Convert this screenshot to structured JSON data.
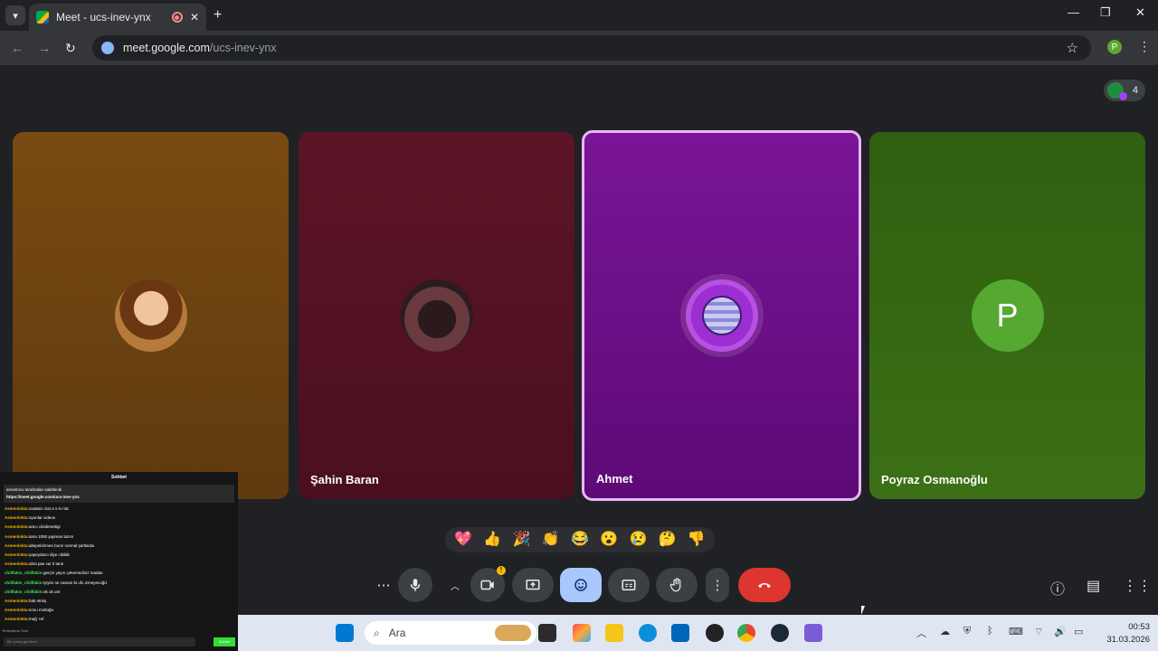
{
  "browser": {
    "tab_title": "Meet - ucs-inev-ynx",
    "url_host": "meet.google.com",
    "url_path": "/ucs-inev-ynx",
    "profile_initial": "P"
  },
  "meet": {
    "participant_count": "4",
    "participants": [
      {
        "name": ""
      },
      {
        "name": "Şahin Baran"
      },
      {
        "name": "Ahmet"
      },
      {
        "name": "Poyraz Osmanoğlu",
        "initial": "P"
      }
    ],
    "reactions": [
      "💖",
      "👍",
      "🎉",
      "👏",
      "😂",
      "😮",
      "😢",
      "🤔",
      "👎"
    ]
  },
  "chat_overlay": {
    "title": "Sohbet",
    "pinned_line1": "amanlocu tarafından sabitlendi",
    "pinned_line2": "https://meet.google.com/ucs-inev-ynx",
    "messages": [
      {
        "user": "Asmenlokta:",
        "text": "oodasin clat a s in ntic"
      },
      {
        "user": "Asmenlokta:",
        "text": "oyunlar videos"
      },
      {
        "user": "Asmenlokta:",
        "text": "amcı cikidenettigi"
      },
      {
        "user": "Asmenlokta:",
        "text": "ama 1000 yapman lazım"
      },
      {
        "user": "Asmenlokta:",
        "text": "altepeldirmen bunn normal şartlarda"
      },
      {
        "user": "Asmenlokta:",
        "text": "yapeydazo diye cikildir"
      },
      {
        "user": "Asmenlokta:",
        "text": "ultra pas var ti tane"
      },
      {
        "user": "chillfakin_chillfakin:",
        "text": "gerçin yayın çekemediniz madan",
        "alt": true
      },
      {
        "user": "chillfakin_chillfakin:",
        "text": "iyiyim ne zaman bi ufo izmeyecoğiz",
        "alt": true
      },
      {
        "user": "chillfakin_chillfakin:",
        "text": "ok ok unt",
        "alt": true
      },
      {
        "user": "Asmenlokta:",
        "text": "hak etmiş"
      },
      {
        "user": "Asmenlokta:",
        "text": "sonu mutluğu"
      },
      {
        "user": "Asmenlokta:",
        "text": "mağ +ef"
      }
    ],
    "footer": "Yerleştirme Öznl",
    "input_placeholder": "Bir mesaj gönderin",
    "send_label": "Sohbet"
  },
  "taskbar": {
    "search_placeholder": "Ara",
    "time": "00:53",
    "date": "31.03.2026"
  },
  "colors": {
    "meet_bg": "#202124",
    "leave_red": "#dc362e",
    "active_border": "#e8b6f4",
    "reaction_active": "#a8c7fa"
  }
}
